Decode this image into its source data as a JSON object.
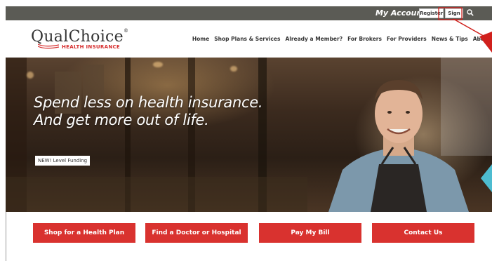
{
  "account_bar": {
    "label": "My Account:",
    "register_label": "Register",
    "signin_label": "Sign in"
  },
  "logo": {
    "brand_part1": "Qual",
    "brand_part2": "Choice",
    "registered": "®",
    "tagline": "HEALTH INSURANCE"
  },
  "nav": {
    "items": [
      "Home",
      "Shop Plans & Services",
      "Already a Member?",
      "For Brokers",
      "For Providers",
      "News & Tips",
      "About"
    ]
  },
  "hero": {
    "title_line1": "Spend less on health insurance.",
    "title_line2": "And get more out of life.",
    "badge": "NEW! Level Funding"
  },
  "cta": {
    "shop": "Shop for a Health Plan",
    "doctor": "Find a Doctor or Hospital",
    "pay": "Pay My Bill",
    "contact": "Contact Us"
  },
  "colors": {
    "brand_red": "#d9322f",
    "account_bar": "#5b5b55",
    "accent_teal": "#4dbcd0",
    "annotation": "#d0201c"
  }
}
